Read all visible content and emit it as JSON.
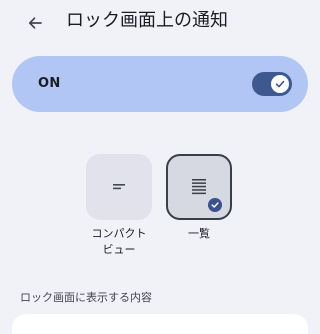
{
  "header": {
    "title": "ロック画面上の通知",
    "back_icon": "arrow-left-icon"
  },
  "main_switch": {
    "label": "ON",
    "state": "on",
    "color": "#b1c6f5"
  },
  "display_options": [
    {
      "label": "コンパクト\nビュー",
      "icon": "compact-lines-icon",
      "selected": false
    },
    {
      "label": "一覧",
      "icon": "list-lines-icon",
      "selected": true
    }
  ],
  "section": {
    "label": "ロック画面に表示する内容"
  },
  "colors": {
    "background": "#f1f1f8",
    "accent": "#3c5a91",
    "selected_border": "#3b3d47"
  }
}
